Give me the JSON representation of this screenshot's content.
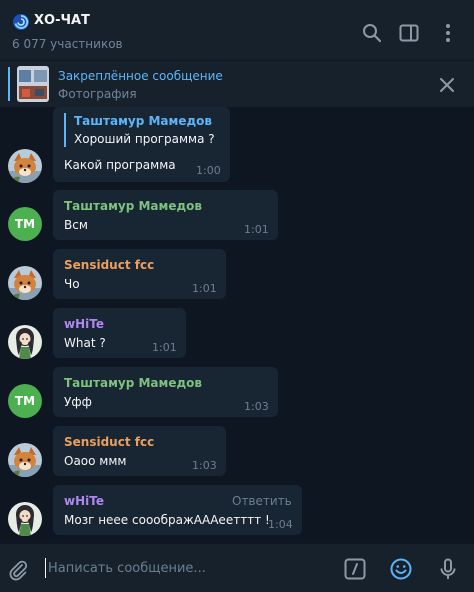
{
  "header": {
    "title": "ХО-ЧАТ",
    "subtitle": "6 077 участников",
    "icons": [
      "search-icon",
      "sidebar-icon",
      "more-icon"
    ]
  },
  "pinned": {
    "title": "Закреплённое сообщение",
    "subtitle": "Фотография",
    "icons": [
      "close-icon"
    ]
  },
  "messages": [
    {
      "reply_to_name": "Таштамур Мамедов",
      "reply_to_text": "Хороший программа ?",
      "text": "Какой программа",
      "time": "1:00",
      "avatar": "fox"
    },
    {
      "sender": "Таштамур Мамедов",
      "text": "Всм",
      "time": "1:01",
      "avatar_initials": "ТМ"
    },
    {
      "sender": "Sensiduct fcc",
      "text": "Чо",
      "time": "1:01",
      "avatar": "fox"
    },
    {
      "sender": "wHiTe",
      "text": "What ?",
      "time": "1:01",
      "avatar": "girl"
    },
    {
      "sender": "Таштамур Мамедов",
      "text": "Уфф",
      "time": "1:03",
      "avatar_initials": "ТМ"
    },
    {
      "sender": "Sensiduct fcc",
      "text": "Оаоо ммм",
      "time": "1:03",
      "avatar": "fox"
    },
    {
      "sender": "wHiTe",
      "text": "Мозг неее сооображАААеетттт !",
      "time": "1:04",
      "avatar": "girl",
      "reply_action": "Ответить"
    }
  ],
  "composer": {
    "placeholder": "Написать сообщение...",
    "icons": [
      "attach-icon",
      "commands-icon",
      "emoji-icon",
      "microphone-icon"
    ]
  },
  "colors": {
    "background": "#0e1621",
    "panel": "#17212b",
    "bubble": "#182533",
    "accent": "#5eb5f7",
    "name_green": "#7ec27e",
    "name_orange": "#ee9f5c",
    "name_purple": "#b087f0",
    "muted": "#6d7f8f"
  }
}
